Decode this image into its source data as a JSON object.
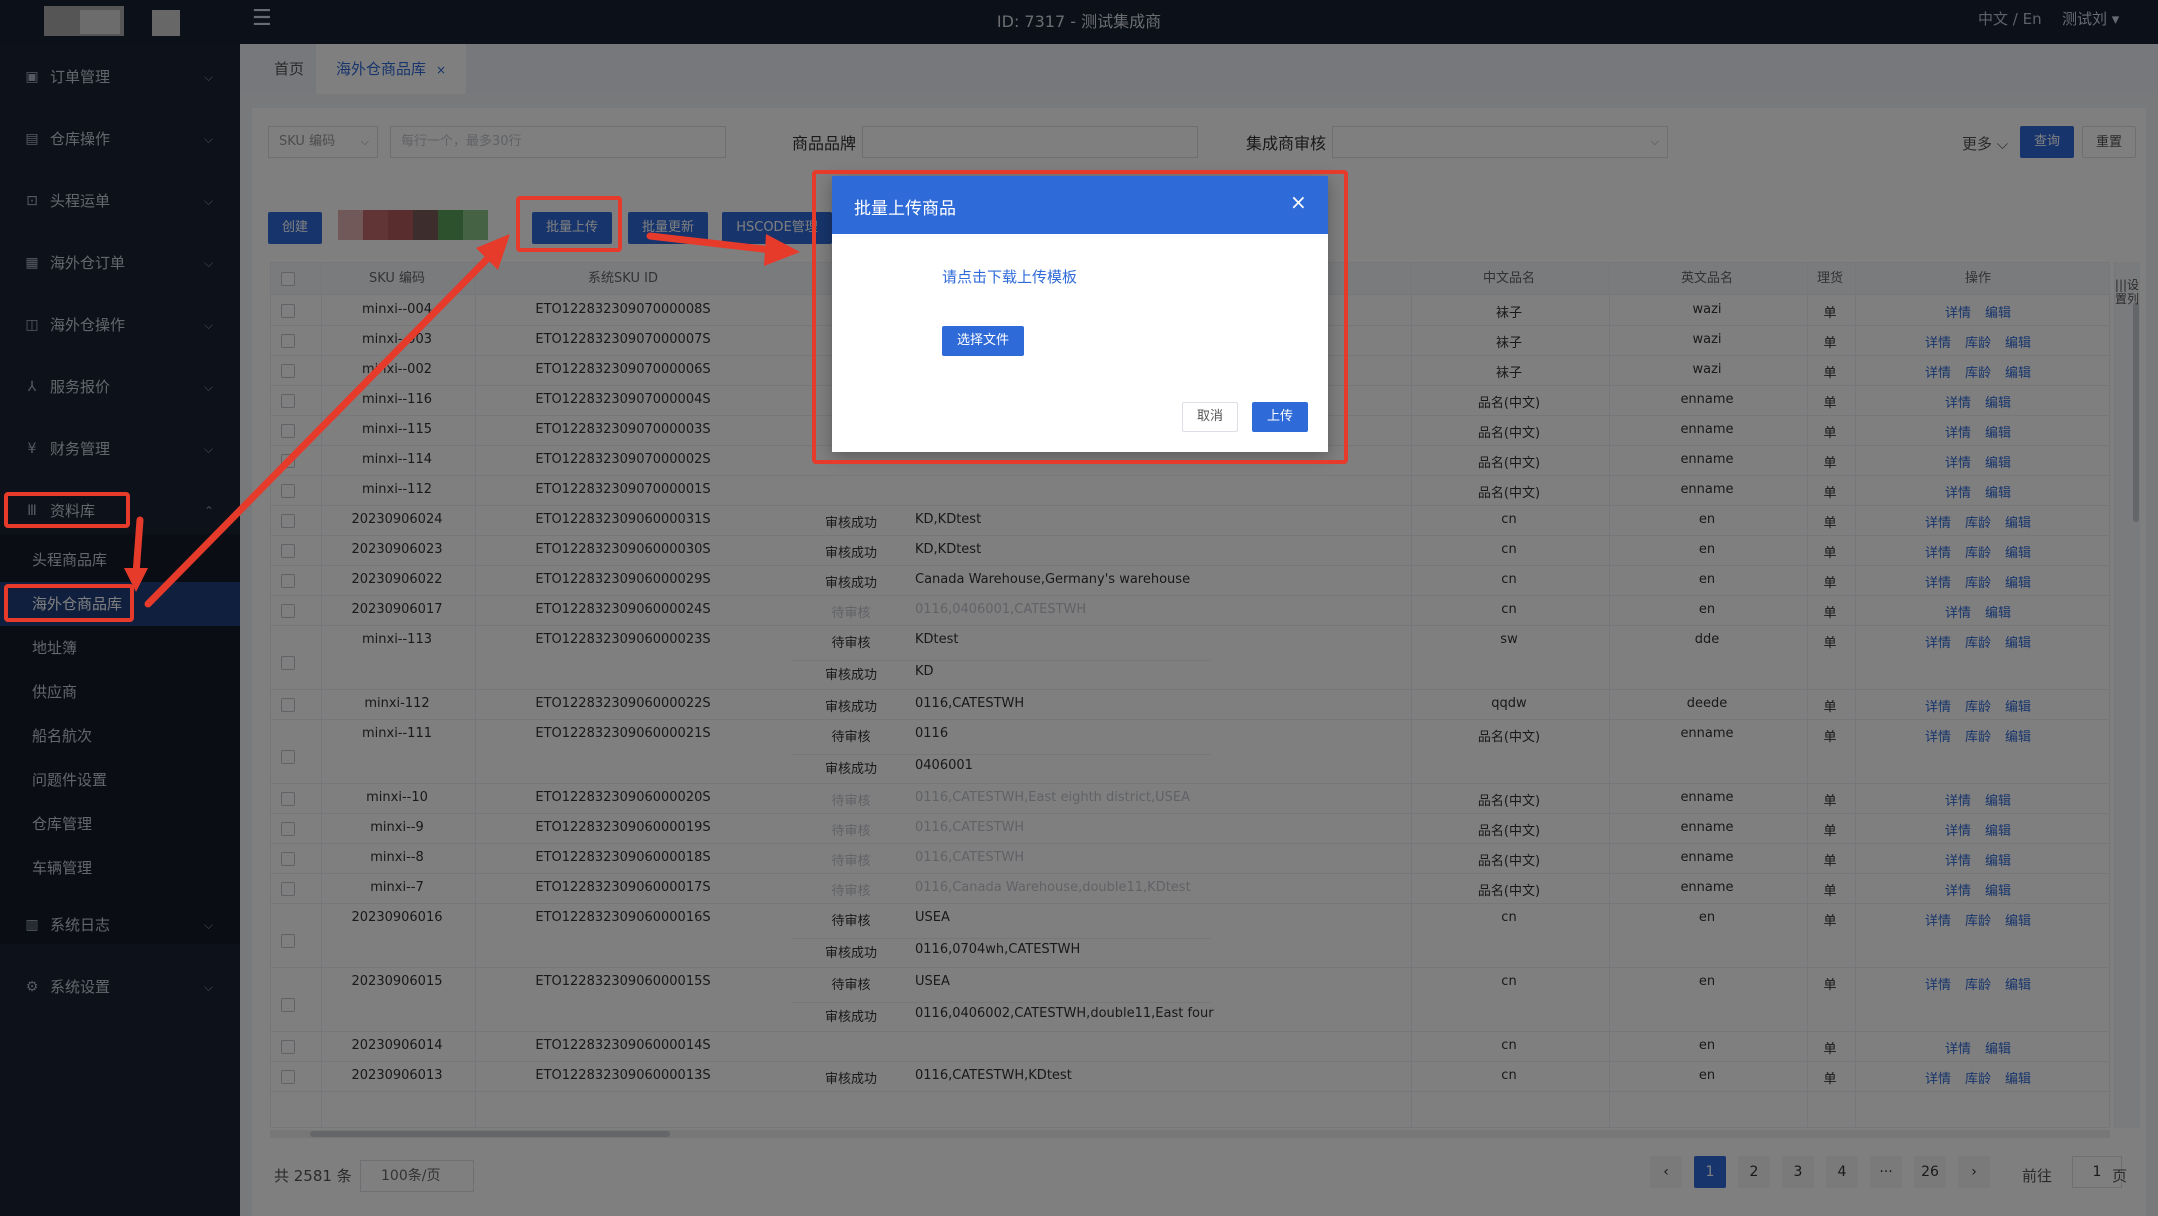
{
  "header": {
    "title": "ID: 7317 - 测试集成商",
    "lang": "中文 / En",
    "user": "测试刘 ▾"
  },
  "sidebar": {
    "items": [
      {
        "label": "订单管理",
        "icon": "order-icon"
      },
      {
        "label": "仓库操作",
        "icon": "warehouse-icon"
      },
      {
        "label": "头程运单",
        "icon": "lock-icon"
      },
      {
        "label": "海外仓订单",
        "icon": "document-icon"
      },
      {
        "label": "海外仓操作",
        "icon": "box-icon"
      },
      {
        "label": "服务报价",
        "icon": "network-icon"
      },
      {
        "label": "财务管理",
        "icon": "currency-icon"
      },
      {
        "label": "资料库",
        "icon": "library-icon"
      },
      {
        "label": "系统日志",
        "icon": "calendar-icon"
      },
      {
        "label": "系统设置",
        "icon": "settings-icon"
      }
    ],
    "sub_items": [
      "头程商品库",
      "海外仓商品库",
      "地址簿",
      "供应商",
      "船名航次",
      "问题件设置",
      "仓库管理",
      "车辆管理"
    ]
  },
  "tabs": [
    {
      "label": "首页"
    },
    {
      "label": "海外仓商品库",
      "close": "×"
    }
  ],
  "filters": {
    "sku_select": "SKU 编码",
    "sku_placeholder": "每行一个，最多30行",
    "brand_label": "商品品牌",
    "audit_label": "集成商审核",
    "more": "更多",
    "search": "查询",
    "reset": "重置"
  },
  "toolbar": {
    "create": "创建",
    "batch_upload": "批量上传",
    "batch_update": "批量更新",
    "hscode": "HSCODE管理"
  },
  "table": {
    "headers": [
      "SKU 编码",
      "系统SKU ID",
      "中文品名",
      "英文品名",
      "理货",
      "操作"
    ],
    "settings_col": "|||设置列",
    "rows": [
      {
        "sku": "minxi--004",
        "sys": "ETO12283230907000008S",
        "audit": [],
        "cn": "袜子",
        "en": "wazi",
        "u": "单",
        "ops": [
          "详情",
          "编辑"
        ]
      },
      {
        "sku": "minxi--003",
        "sys": "ETO12283230907000007S",
        "audit": [],
        "cn": "袜子",
        "en": "wazi",
        "u": "单",
        "ops": [
          "详情",
          "库龄",
          "编辑"
        ]
      },
      {
        "sku": "minxi--002",
        "sys": "ETO12283230907000006S",
        "audit": [],
        "cn": "袜子",
        "en": "wazi",
        "u": "单",
        "ops": [
          "详情",
          "库龄",
          "编辑"
        ]
      },
      {
        "sku": "minxi--116",
        "sys": "ETO12283230907000004S",
        "audit": [],
        "cn": "品名(中文)",
        "en": "enname",
        "u": "单",
        "ops": [
          "详情",
          "编辑"
        ]
      },
      {
        "sku": "minxi--115",
        "sys": "ETO12283230907000003S",
        "audit": [],
        "cn": "品名(中文)",
        "en": "enname",
        "u": "单",
        "ops": [
          "详情",
          "编辑"
        ]
      },
      {
        "sku": "minxi--114",
        "sys": "ETO12283230907000002S",
        "audit": [],
        "cn": "品名(中文)",
        "en": "enname",
        "u": "单",
        "ops": [
          "详情",
          "编辑"
        ]
      },
      {
        "sku": "minxi--112",
        "sys": "ETO12283230907000001S",
        "audit": [],
        "cn": "品名(中文)",
        "en": "enname",
        "u": "单",
        "ops": [
          "详情",
          "编辑"
        ]
      },
      {
        "sku": "20230906024",
        "sys": "ETO12283230906000031S",
        "audit": [
          {
            "s": "审核成功",
            "w": "KD,KDtest"
          }
        ],
        "cn": "cn",
        "en": "en",
        "u": "单",
        "ops": [
          "详情",
          "库龄",
          "编辑"
        ]
      },
      {
        "sku": "20230906023",
        "sys": "ETO12283230906000030S",
        "audit": [
          {
            "s": "审核成功",
            "w": "KD,KDtest"
          }
        ],
        "cn": "cn",
        "en": "en",
        "u": "单",
        "ops": [
          "详情",
          "库龄",
          "编辑"
        ]
      },
      {
        "sku": "20230906022",
        "sys": "ETO12283230906000029S",
        "audit": [
          {
            "s": "审核成功",
            "w": "Canada Warehouse,Germany's warehouse"
          }
        ],
        "cn": "cn",
        "en": "en",
        "u": "单",
        "ops": [
          "详情",
          "库龄",
          "编辑"
        ]
      },
      {
        "sku": "20230906017",
        "sys": "ETO12283230906000024S",
        "audit": [
          {
            "s": "待审核",
            "w": "0116,0406001,CATESTWH",
            "faded": true
          }
        ],
        "cn": "cn",
        "en": "en",
        "u": "单",
        "ops": [
          "详情",
          "编辑"
        ]
      },
      {
        "sku": "minxi--113",
        "sys": "ETO12283230906000023S",
        "audit": [
          {
            "s": "待审核",
            "w": "KDtest"
          },
          {
            "s": "审核成功",
            "w": "KD"
          }
        ],
        "cn": "sw",
        "en": "dde",
        "u": "单",
        "ops": [
          "详情",
          "库龄",
          "编辑"
        ]
      },
      {
        "sku": "minxi-112",
        "sys": "ETO12283230906000022S",
        "audit": [
          {
            "s": "审核成功",
            "w": "0116,CATESTWH"
          }
        ],
        "cn": "qqdw",
        "en": "deede",
        "u": "单",
        "ops": [
          "详情",
          "库龄",
          "编辑"
        ]
      },
      {
        "sku": "minxi--111",
        "sys": "ETO12283230906000021S",
        "audit": [
          {
            "s": "待审核",
            "w": "0116"
          },
          {
            "s": "审核成功",
            "w": "0406001"
          }
        ],
        "cn": "品名(中文)",
        "en": "enname",
        "u": "单",
        "ops": [
          "详情",
          "库龄",
          "编辑"
        ]
      },
      {
        "sku": "minxi--10",
        "sys": "ETO12283230906000020S",
        "audit": [
          {
            "s": "待审核",
            "w": "0116,CATESTWH,East eighth district,USEA",
            "faded": true
          }
        ],
        "cn": "品名(中文)",
        "en": "enname",
        "u": "单",
        "ops": [
          "详情",
          "编辑"
        ]
      },
      {
        "sku": "minxi--9",
        "sys": "ETO12283230906000019S",
        "audit": [
          {
            "s": "待审核",
            "w": "0116,CATESTWH",
            "faded": true
          }
        ],
        "cn": "品名(中文)",
        "en": "enname",
        "u": "单",
        "ops": [
          "详情",
          "编辑"
        ]
      },
      {
        "sku": "minxi--8",
        "sys": "ETO12283230906000018S",
        "audit": [
          {
            "s": "待审核",
            "w": "0116,CATESTWH",
            "faded": true
          }
        ],
        "cn": "品名(中文)",
        "en": "enname",
        "u": "单",
        "ops": [
          "详情",
          "编辑"
        ]
      },
      {
        "sku": "minxi--7",
        "sys": "ETO12283230906000017S",
        "audit": [
          {
            "s": "待审核",
            "w": "0116,Canada Warehouse,double11,KDtest",
            "faded": true
          }
        ],
        "cn": "品名(中文)",
        "en": "enname",
        "u": "单",
        "ops": [
          "详情",
          "编辑"
        ]
      },
      {
        "sku": "20230906016",
        "sys": "ETO12283230906000016S",
        "audit": [
          {
            "s": "待审核",
            "w": "USEA"
          },
          {
            "s": "审核成功",
            "w": "0116,0704wh,CATESTWH"
          }
        ],
        "cn": "cn",
        "en": "en",
        "u": "单",
        "ops": [
          "详情",
          "库龄",
          "编辑"
        ]
      },
      {
        "sku": "20230906015",
        "sys": "ETO12283230906000015S",
        "audit": [
          {
            "s": "待审核",
            "w": "USEA"
          },
          {
            "s": "审核成功",
            "w": "0116,0406002,CATESTWH,double11,East four"
          }
        ],
        "cn": "cn",
        "en": "en",
        "u": "单",
        "ops": [
          "详情",
          "库龄",
          "编辑"
        ]
      },
      {
        "sku": "20230906014",
        "sys": "ETO12283230906000014S",
        "audit": [],
        "cn": "cn",
        "en": "en",
        "u": "单",
        "ops": [
          "详情",
          "编辑"
        ]
      },
      {
        "sku": "20230906013",
        "sys": "ETO12283230906000013S",
        "audit": [
          {
            "s": "审核成功",
            "w": "0116,CATESTWH,KDtest"
          }
        ],
        "cn": "cn",
        "en": "en",
        "u": "单",
        "ops": [
          "详情",
          "库龄",
          "编辑"
        ]
      }
    ]
  },
  "pagination": {
    "total": "共 2581 条",
    "page_size": "100条/页",
    "pages": [
      "1",
      "2",
      "3",
      "4",
      "···",
      "26"
    ],
    "prev": "‹",
    "next": "›",
    "goto_prefix": "前往",
    "goto_value": "1",
    "goto_suffix": "页"
  },
  "modal": {
    "title": "批量上传商品",
    "close": "×",
    "download_link": "请点击下载上传模板",
    "choose_file": "选择文件",
    "cancel": "取消",
    "upload": "上传"
  },
  "colors": {
    "primary": "#2f6bd8",
    "sidebar": "#1b2435",
    "header": "#182033",
    "annotation": "#e63a2b"
  }
}
